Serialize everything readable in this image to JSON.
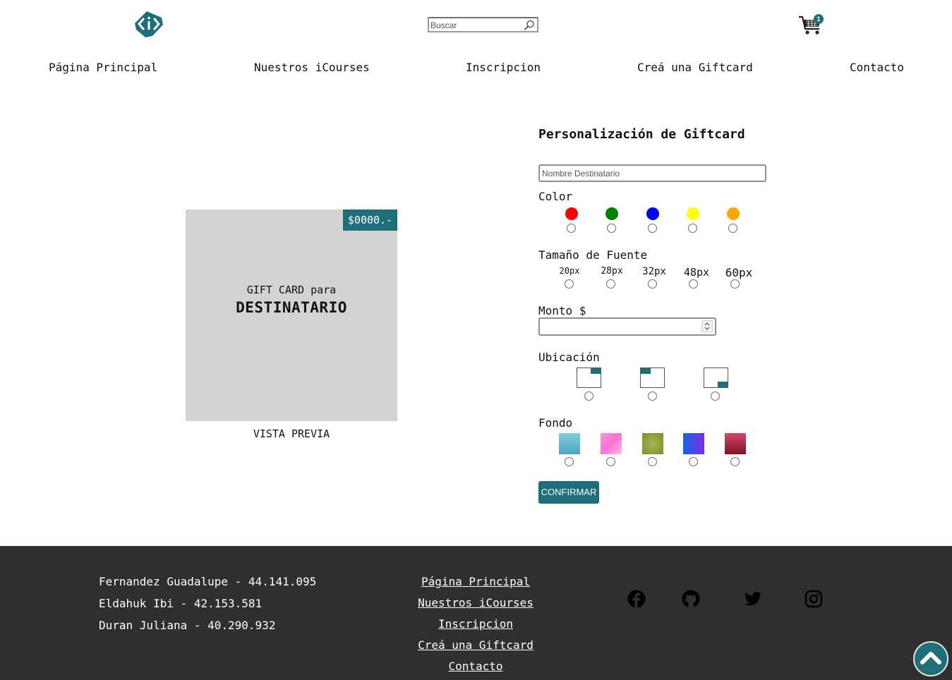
{
  "header": {
    "search": {
      "placeholder": "Buscar"
    },
    "cart": {
      "count": "1"
    },
    "nav": [
      {
        "label": "Página Principal"
      },
      {
        "label": "Nuestros iCourses"
      },
      {
        "label": "Inscripcion"
      },
      {
        "label": "Creá una Giftcard"
      },
      {
        "label": "Contacto"
      }
    ]
  },
  "preview": {
    "price": "$0000.-",
    "line1": "GIFT CARD para",
    "line2": "DESTINATARIO",
    "caption": "VISTA PREVIA",
    "card_color": "#d3d3d3"
  },
  "form": {
    "title": "Personalización de Giftcard",
    "name_placeholder": "Nombre Destinatario",
    "color_label": "Color",
    "colors": [
      "#ff0000",
      "#008000",
      "#0000ff",
      "#ffff00",
      "#ffa500"
    ],
    "font_label": "Tamaño de Fuente",
    "font_sizes": [
      "20px",
      "28px",
      "32px",
      "48px",
      "60px"
    ],
    "monto_label": "Monto $",
    "monto_value": "",
    "ubicacion_label": "Ubicación",
    "ubicaciones": [
      "top-right",
      "top-left",
      "bottom-right"
    ],
    "fondo_label": "Fondo",
    "fondos": [
      "sky-blue-gradient",
      "pink-gradient",
      "olive-radial",
      "blue-purple-gradient",
      "crimson-gradient"
    ],
    "confirm_label": "CONFIRMAR",
    "accent": "#1f6f7a"
  },
  "footer": {
    "credits": [
      "Fernandez Guadalupe - 44.141.095",
      "Eldahuk Ibi - 42.153.581",
      "Duran Juliana - 40.290.932"
    ],
    "links": [
      "Página Principal",
      "Nuestros iCourses",
      "Inscripcion",
      "Creá una Giftcard",
      "Contacto"
    ],
    "social": [
      "facebook-icon",
      "github-icon",
      "twitter-icon",
      "instagram-icon"
    ],
    "background": "#2f2f2f"
  }
}
